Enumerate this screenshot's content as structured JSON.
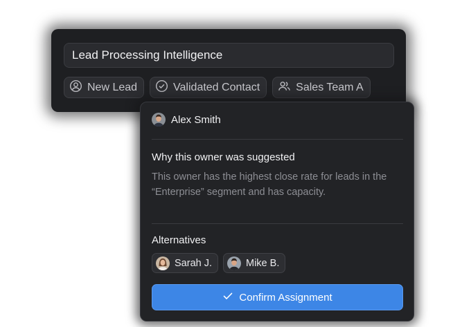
{
  "lead": {
    "title": "Lead Processing Intelligence",
    "tags": [
      {
        "label": "New Lead",
        "icon": "user-circle-icon"
      },
      {
        "label": "Validated Contact",
        "icon": "check-circle-icon"
      },
      {
        "label": "Sales Team A",
        "icon": "users-icon"
      }
    ]
  },
  "suggestion": {
    "owner_name": "Alex Smith",
    "reason_title": "Why this owner was suggested",
    "reason_text": "This owner has the highest close rate for leads in the “Enterprise” segment and has capacity.",
    "alternatives_title": "Alternatives",
    "alternatives": [
      {
        "name": "Sarah J.",
        "icon": "avatar-female"
      },
      {
        "name": "Mike B.",
        "icon": "avatar-male"
      }
    ],
    "confirm_label": "Confirm Assignment"
  },
  "colors": {
    "accent": "#3d86e6",
    "panel": "#222326",
    "card": "#1e1f22"
  }
}
